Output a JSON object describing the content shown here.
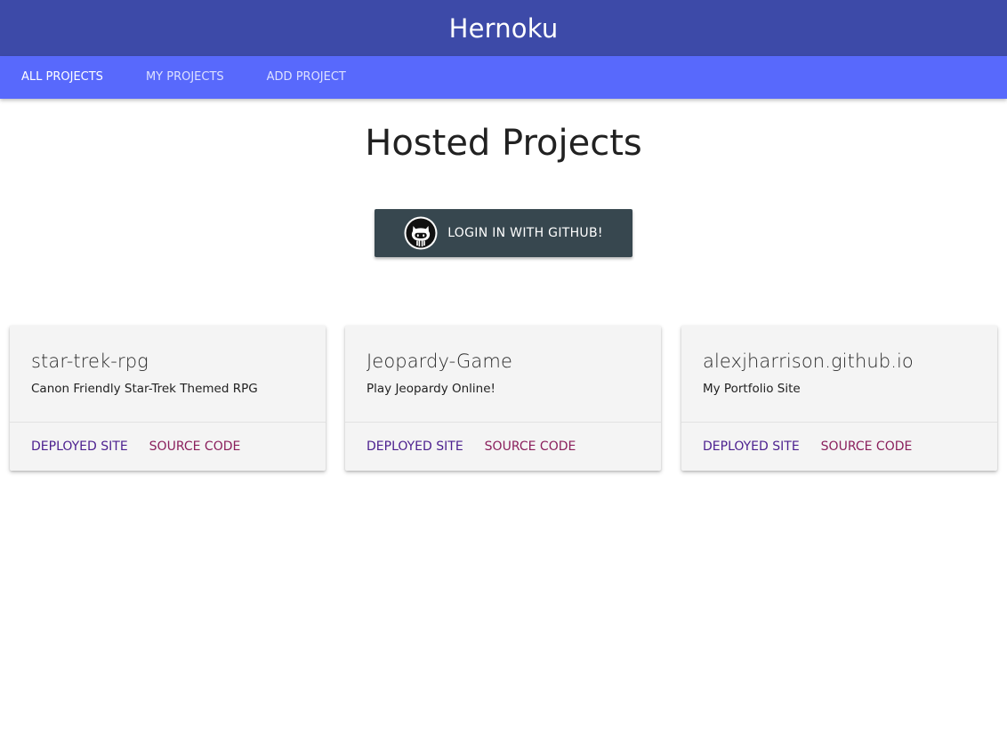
{
  "app": {
    "brand": "Hernoku"
  },
  "nav": {
    "items": [
      {
        "label": "ALL PROJECTS",
        "active": true
      },
      {
        "label": "MY PROJECTS",
        "active": false
      },
      {
        "label": "ADD PROJECT",
        "active": false
      }
    ]
  },
  "main": {
    "title": "Hosted Projects",
    "login_button": {
      "label": "LOGIN IN WITH GITHUB!",
      "icon": "github-octocat-icon"
    }
  },
  "projects": [
    {
      "title": "star-trek-rpg",
      "description": "Canon Friendly Star-Trek Themed RPG",
      "deployed_label": "DEPLOYED SITE",
      "source_label": "SOURCE CODE"
    },
    {
      "title": "Jeopardy-Game",
      "description": "Play Jeopardy Online!",
      "deployed_label": "DEPLOYED SITE",
      "source_label": "SOURCE CODE"
    },
    {
      "title": "alexjharrison.github.io",
      "description": "My Portfolio Site",
      "deployed_label": "DEPLOYED SITE",
      "source_label": "SOURCE CODE"
    }
  ],
  "colors": {
    "topbar": "#3d4aa8",
    "navbar": "#5869fc",
    "button": "#37474f",
    "link_deployed": "#4b1f8e",
    "link_source": "#8a1f5c"
  }
}
